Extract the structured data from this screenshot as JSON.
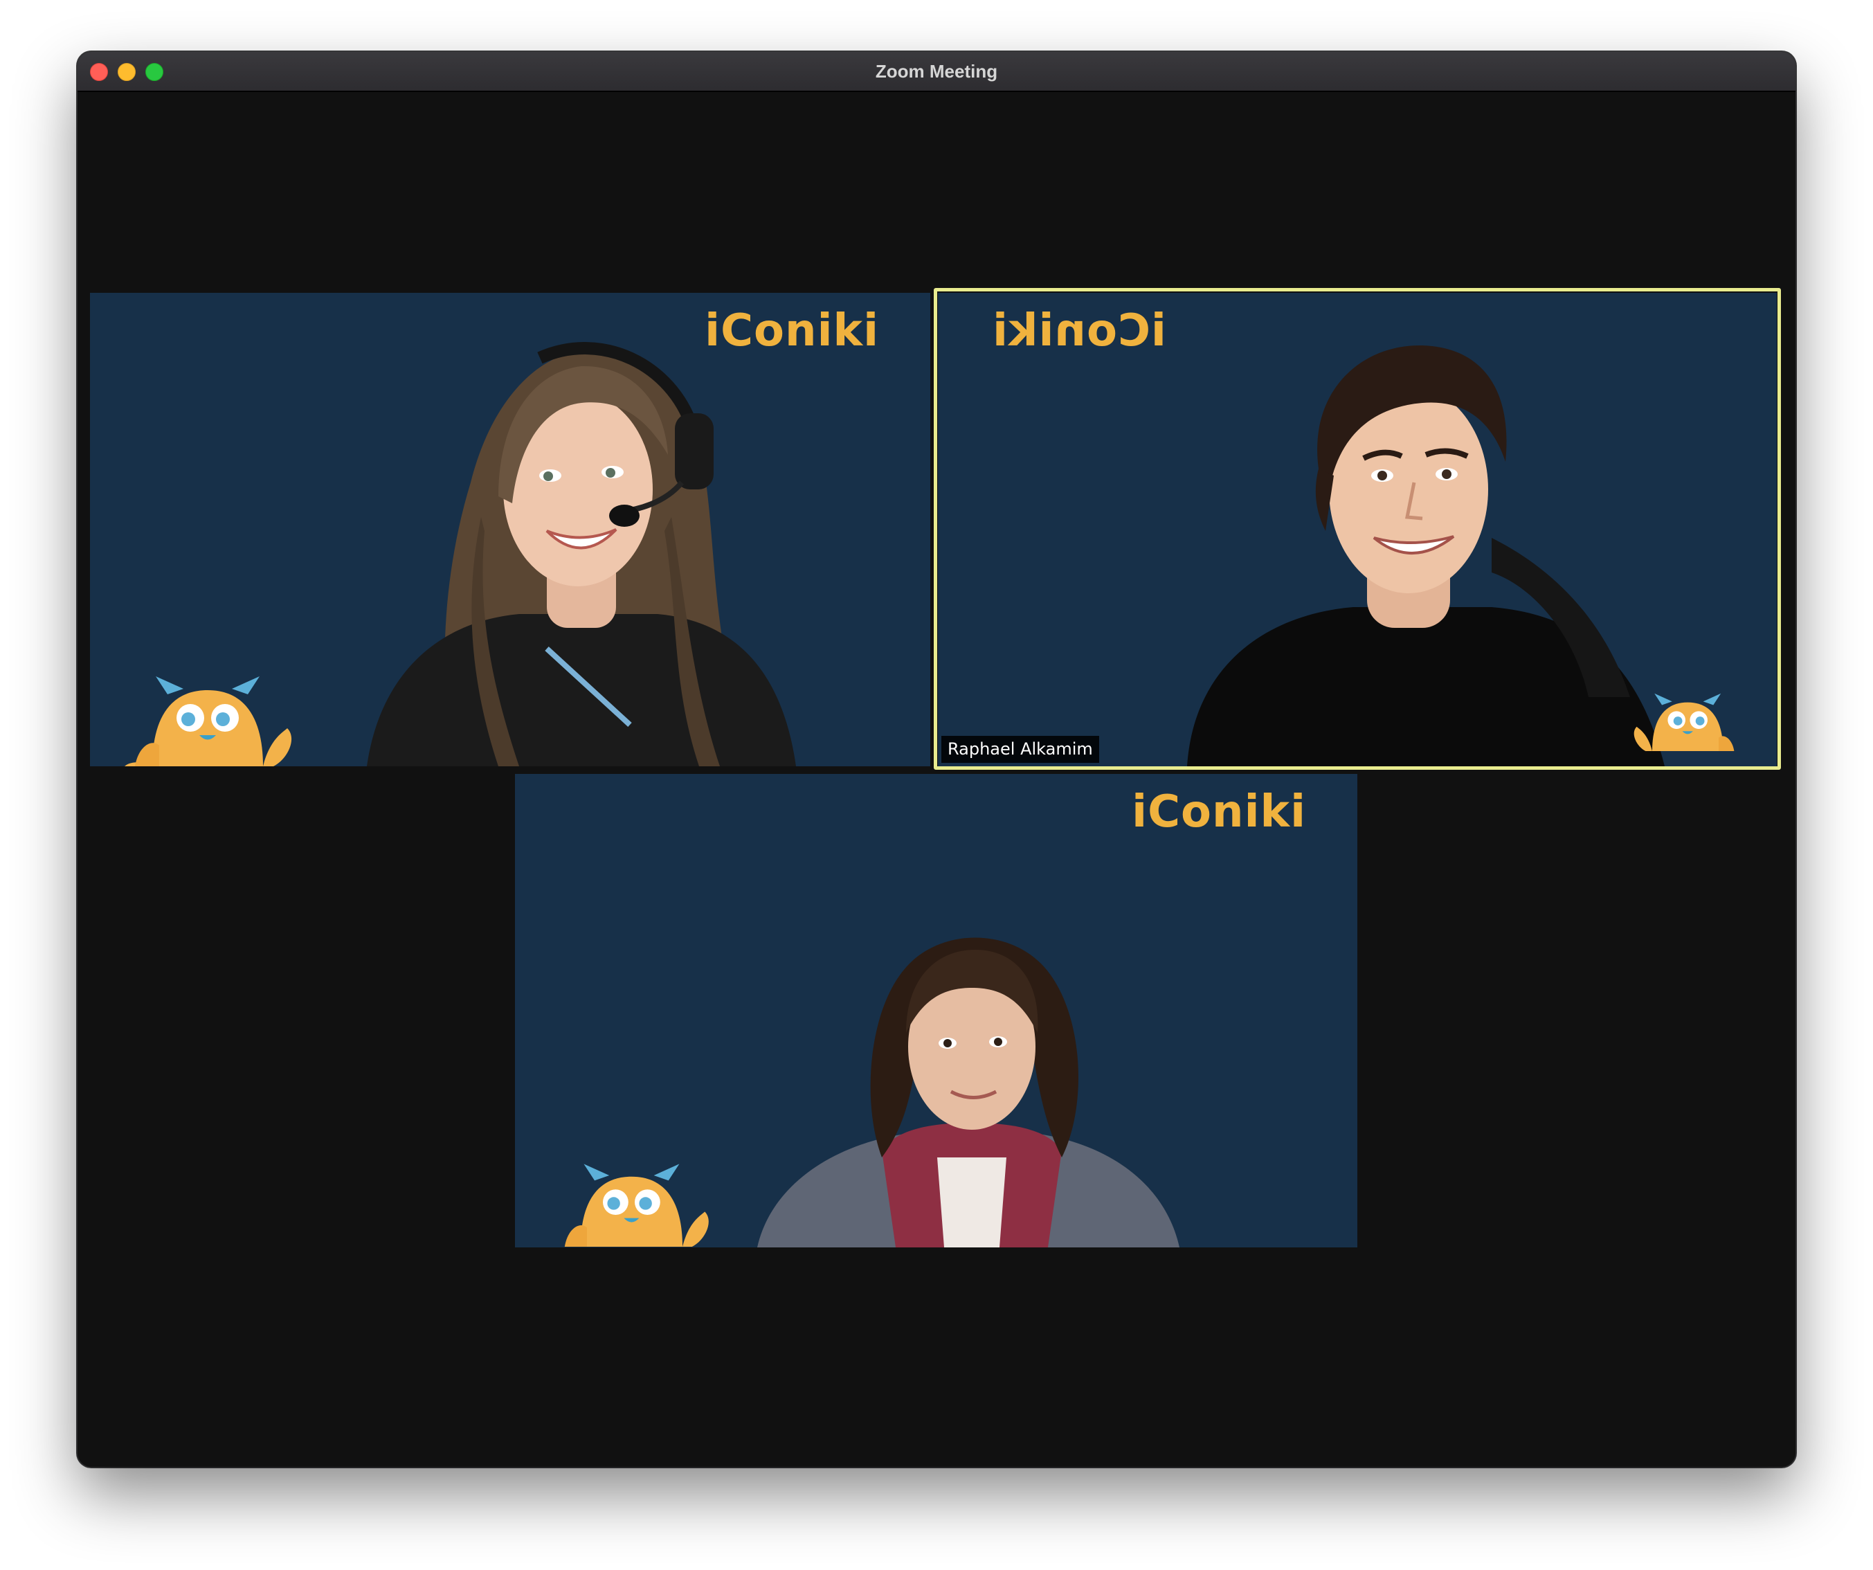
{
  "window": {
    "title": "Zoom Meeting"
  },
  "participants": [
    {
      "brand": "iConiki",
      "name_label": "",
      "active_speaker": false,
      "mirrored_background": false
    },
    {
      "brand": "iConiki",
      "name_label": "Raphael Alkamim",
      "active_speaker": true,
      "mirrored_background": true
    },
    {
      "brand": "iConiki",
      "name_label": "",
      "active_speaker": false,
      "mirrored_background": false
    }
  ],
  "colors": {
    "tile_background": "#173049",
    "brand": "#f0b23e",
    "mascot_body": "#f3b24a",
    "active_speaker_border": "#e9ec8f",
    "window_background": "#111111"
  },
  "icons": {
    "close": "close-window-icon",
    "minimize": "minimize-window-icon",
    "maximize": "maximize-window-icon",
    "mascot": "iconiki-mascot-icon"
  }
}
